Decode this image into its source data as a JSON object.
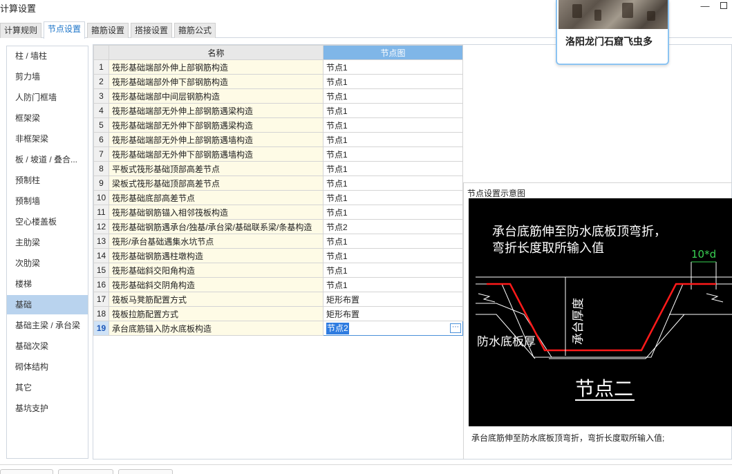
{
  "window": {
    "title": "计算设置"
  },
  "tabs": [
    {
      "label": "计算规则",
      "active": false
    },
    {
      "label": "节点设置",
      "active": true
    },
    {
      "label": "箍筋设置",
      "active": false
    },
    {
      "label": "搭接设置",
      "active": false
    },
    {
      "label": "箍筋公式",
      "active": false
    }
  ],
  "sidebar": {
    "selected_index": 13,
    "items": [
      {
        "label": "柱 / 墙柱"
      },
      {
        "label": "剪力墙"
      },
      {
        "label": "人防门框墙"
      },
      {
        "label": "框架梁"
      },
      {
        "label": "非框架梁"
      },
      {
        "label": "板 / 坡道 / 叠合..."
      },
      {
        "label": "预制柱"
      },
      {
        "label": "预制墙"
      },
      {
        "label": "空心楼盖板"
      },
      {
        "label": "主肋梁"
      },
      {
        "label": "次肋梁"
      },
      {
        "label": "楼梯"
      },
      {
        "label": "基础"
      },
      {
        "label": "基础主梁 / 承台梁"
      },
      {
        "label": "基础次梁"
      },
      {
        "label": "砌体结构"
      },
      {
        "label": "其它"
      },
      {
        "label": "基坑支护"
      }
    ]
  },
  "table": {
    "columns": {
      "name": "名称",
      "node": "节点图"
    },
    "current_row": 19,
    "rows": [
      {
        "num": "1",
        "name": "筏形基础端部外伸上部钢筋构造",
        "node": "节点1"
      },
      {
        "num": "2",
        "name": "筏形基础端部外伸下部钢筋构造",
        "node": "节点1"
      },
      {
        "num": "3",
        "name": "筏形基础端部中间层钢筋构造",
        "node": "节点1"
      },
      {
        "num": "4",
        "name": "筏形基础端部无外伸上部钢筋遇梁构造",
        "node": "节点1"
      },
      {
        "num": "5",
        "name": "筏形基础端部无外伸下部钢筋遇梁构造",
        "node": "节点1"
      },
      {
        "num": "6",
        "name": "筏形基础端部无外伸上部钢筋遇墙构造",
        "node": "节点1"
      },
      {
        "num": "7",
        "name": "筏形基础端部无外伸下部钢筋遇墙构造",
        "node": "节点1"
      },
      {
        "num": "8",
        "name": "平板式筏形基础顶部高差节点",
        "node": "节点1"
      },
      {
        "num": "9",
        "name": "梁板式筏形基础顶部高差节点",
        "node": "节点1"
      },
      {
        "num": "10",
        "name": "筏形基础底部高差节点",
        "node": "节点1"
      },
      {
        "num": "11",
        "name": "筏形基础钢筋锚入相邻筏板构造",
        "node": "节点1"
      },
      {
        "num": "12",
        "name": "筏形基础钢筋遇承台/独基/承台梁/基础联系梁/条基构造",
        "node": "节点2"
      },
      {
        "num": "13",
        "name": "筏形/承台基础遇集水坑节点",
        "node": "节点1"
      },
      {
        "num": "14",
        "name": "筏形基础钢筋遇柱墩构造",
        "node": "节点1"
      },
      {
        "num": "15",
        "name": "筏形基础斜交阳角构造",
        "node": "节点1"
      },
      {
        "num": "16",
        "name": "筏形基础斜交阴角构造",
        "node": "节点1"
      },
      {
        "num": "17",
        "name": "筏板马凳筋配置方式",
        "node": "矩形布置"
      },
      {
        "num": "18",
        "name": "筏板拉筋配置方式",
        "node": "矩形布置"
      },
      {
        "num": "19",
        "name": "承台底筋锚入防水底板构造",
        "node": "节点2"
      }
    ],
    "edit_button": "⋯"
  },
  "preview": {
    "title": "节点设置示意图",
    "diagram": {
      "line1": "承台底筋伸至防水底板顶弯折，",
      "line2": "弯折长度取所输入值",
      "dim_label": "10*d",
      "thickness_label": "承台厚度",
      "waterproof_label": "防水底板厚",
      "node_title": "节点二"
    },
    "description": "承台底筋伸至防水底板顶弯折，弯折长度取所输入值;"
  },
  "popup": {
    "title": "洛阳龙门石窟飞虫多"
  },
  "colors": {
    "accent": "#1a73c8",
    "header_selected": "#7fb6e8",
    "name_cell_bg": "#fefbe6",
    "rebar_red": "#ff1a1a",
    "dim_green": "#39d353"
  }
}
